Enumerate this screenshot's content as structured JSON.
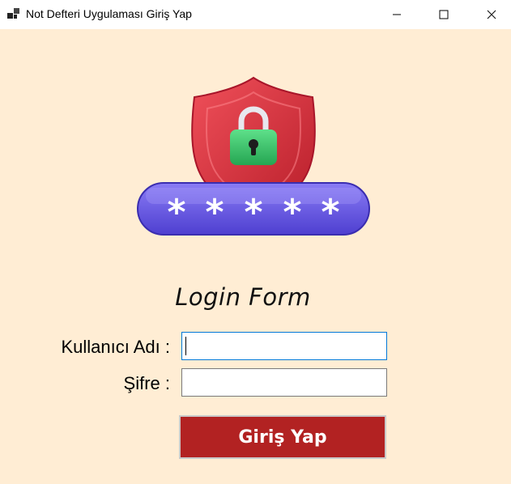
{
  "window": {
    "title": "Not Defteri Uygulaması Giriş Yap",
    "icon": "windows-app-icon",
    "controls": [
      "minimize-icon",
      "maximize-icon",
      "close-icon"
    ]
  },
  "hero": {
    "image": "shield-lock-password-icon",
    "password_mask": "*****"
  },
  "form": {
    "title": "Login Form",
    "username_label": "Kullanıcı Adı :",
    "username_value": "",
    "password_label": "Şifre :",
    "password_value": "",
    "submit_label": "Giriş Yap"
  },
  "colors": {
    "background": "#ffedd4",
    "button": "#b22222",
    "shield": "#e0303a",
    "lock": "#3cc46a",
    "password_bar": "#6a5ae0"
  }
}
